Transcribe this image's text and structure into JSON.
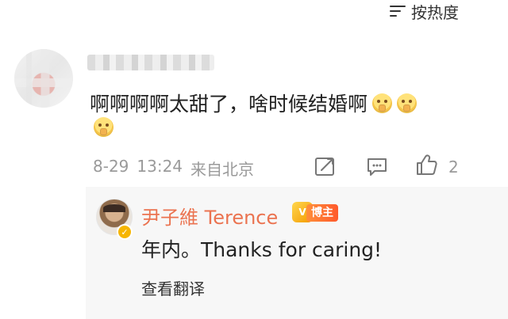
{
  "sort": {
    "icon": "sort-icon",
    "label": "按热度"
  },
  "comment": {
    "text": "啊啊啊啊太甜了，啥时候结婚啊",
    "emoji_name": "pray-emoji",
    "meta": {
      "date": "8-29",
      "time": "13:24",
      "location": "来自北京"
    },
    "actions": {
      "repost_icon": "repost-icon",
      "comment_icon": "comment-icon",
      "like_icon": "like-icon",
      "like_count": "2"
    }
  },
  "reply": {
    "author": "尹子維 Terence",
    "badge": "博主",
    "text": "年内。Thanks for caring!",
    "translate": "查看翻译",
    "verified_icon": "verified-icon"
  },
  "colors": {
    "name": "#eb7350",
    "meta": "#9a9a9a",
    "badge": "#ff6a2d"
  }
}
